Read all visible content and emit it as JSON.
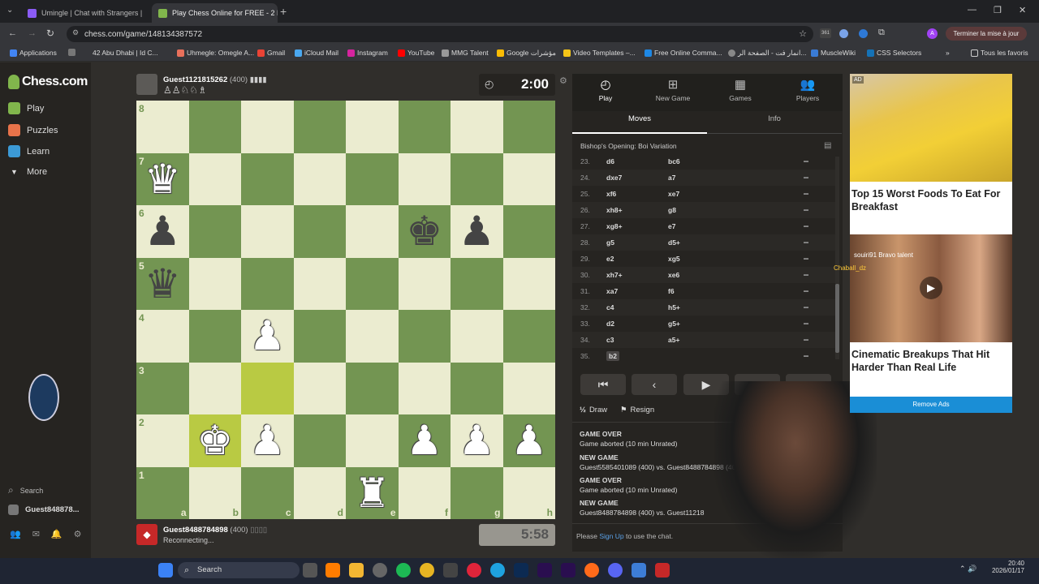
{
  "browser": {
    "tabs": [
      {
        "title": "Umingle | Chat with Strangers |",
        "active": false
      },
      {
        "title": "Play Chess Online for FREE - 2 P",
        "active": true
      }
    ],
    "url": "chess.com/game/148134387572",
    "update_label": "Terminer la mise à jour",
    "avatar_letter": "A",
    "badge": "361",
    "bookmarks": [
      "Applications",
      "42 Abu Dhabi | Id C...",
      "Uhmegle: Omegle A...",
      "Gmail",
      "iCloud Mail",
      "Instagram",
      "YouTube",
      "MMG Talent",
      "Google مؤشرات",
      "Video Templates –...",
      "Free Online Comma...",
      "انمار فت - الصفحة الر...",
      "MuscleWiki",
      "CSS Selectors"
    ],
    "all_bookmarks": "Tous les favoris"
  },
  "nav": {
    "logo": "Chess.com",
    "items": [
      "Play",
      "Puzzles",
      "Learn",
      "More"
    ],
    "search": "Search",
    "user": "Guest848878..."
  },
  "top_player": {
    "name": "Guest1121815262",
    "rating": "(400)",
    "clock": "2:00"
  },
  "bottom_player": {
    "name": "Guest8488784898",
    "rating": "(400)",
    "status": "Reconnecting...",
    "clock": "5:58"
  },
  "board": {
    "ranks": [
      "8",
      "7",
      "6",
      "5",
      "4",
      "3",
      "2",
      "1"
    ],
    "files": [
      "a",
      "b",
      "c",
      "d",
      "e",
      "f",
      "g",
      "h"
    ],
    "pieces": [
      {
        "sq": "a7",
        "glyph": "♛",
        "color": "w"
      },
      {
        "sq": "a6",
        "glyph": "♟",
        "color": "b"
      },
      {
        "sq": "f6",
        "glyph": "♚",
        "color": "b"
      },
      {
        "sq": "g6",
        "glyph": "♟",
        "color": "b"
      },
      {
        "sq": "a5",
        "glyph": "♛",
        "color": "b"
      },
      {
        "sq": "c4",
        "glyph": "♟",
        "color": "w"
      },
      {
        "sq": "b2",
        "glyph": "♚",
        "color": "w"
      },
      {
        "sq": "c2",
        "glyph": "♟",
        "color": "w"
      },
      {
        "sq": "f2",
        "glyph": "♟",
        "color": "w"
      },
      {
        "sq": "g2",
        "glyph": "♟",
        "color": "w"
      },
      {
        "sq": "h2",
        "glyph": "♟",
        "color": "w"
      },
      {
        "sq": "e1",
        "glyph": "♜",
        "color": "w"
      }
    ],
    "highlights": [
      "c3",
      "b2"
    ]
  },
  "panel": {
    "tabs": [
      "Play",
      "New Game",
      "Games",
      "Players"
    ],
    "subtabs": [
      "Moves",
      "Info"
    ],
    "opening": "Bishop's Opening: Boi Variation",
    "moves": [
      {
        "n": "23.",
        "w": "d6",
        "b": "bc6"
      },
      {
        "n": "24.",
        "w": "dxe7",
        "b": "a7"
      },
      {
        "n": "25.",
        "w": "xf6",
        "b": "xe7"
      },
      {
        "n": "26.",
        "w": "xh8+",
        "b": "g8"
      },
      {
        "n": "27.",
        "w": "xg8+",
        "b": "e7"
      },
      {
        "n": "28.",
        "w": "g5",
        "b": "d5+"
      },
      {
        "n": "29.",
        "w": "e2",
        "b": "xg5"
      },
      {
        "n": "30.",
        "w": "xh7+",
        "b": "xe6"
      },
      {
        "n": "31.",
        "w": "xa7",
        "b": "f6"
      },
      {
        "n": "32.",
        "w": "c4",
        "b": "h5+"
      },
      {
        "n": "33.",
        "w": "d2",
        "b": "g5+"
      },
      {
        "n": "34.",
        "w": "c3",
        "b": "a5+"
      },
      {
        "n": "35.",
        "w": "b2",
        "b": ""
      }
    ],
    "draw": "Draw",
    "resign": "Resign",
    "log": [
      "GAME OVER",
      "Game aborted (10 min Unrated)",
      "NEW GAME",
      "Guest5585401089 (400) vs. Guest8488784898 (400)",
      "GAME OVER",
      "Game aborted (10 min Unrated)",
      "NEW GAME",
      "Guest8488784898 (400) vs. Guest11218"
    ],
    "chat_prefix": "Please ",
    "chat_link": "Sign Up",
    "chat_suffix": " to use the chat."
  },
  "ad": {
    "tag": "AD",
    "headline1": "Top 15 Worst Foods To Eat For Breakfast",
    "headline2": "Cinematic Breakups That Hit Harder Than Real Life",
    "overlay1": "souiri91",
    "overlay2": "Bravo talent",
    "overlay3": "Chaball_dz",
    "remove": "Remove Ads"
  },
  "taskbar": {
    "search": "Search",
    "time": "20:40",
    "date": "2026/01/17"
  }
}
